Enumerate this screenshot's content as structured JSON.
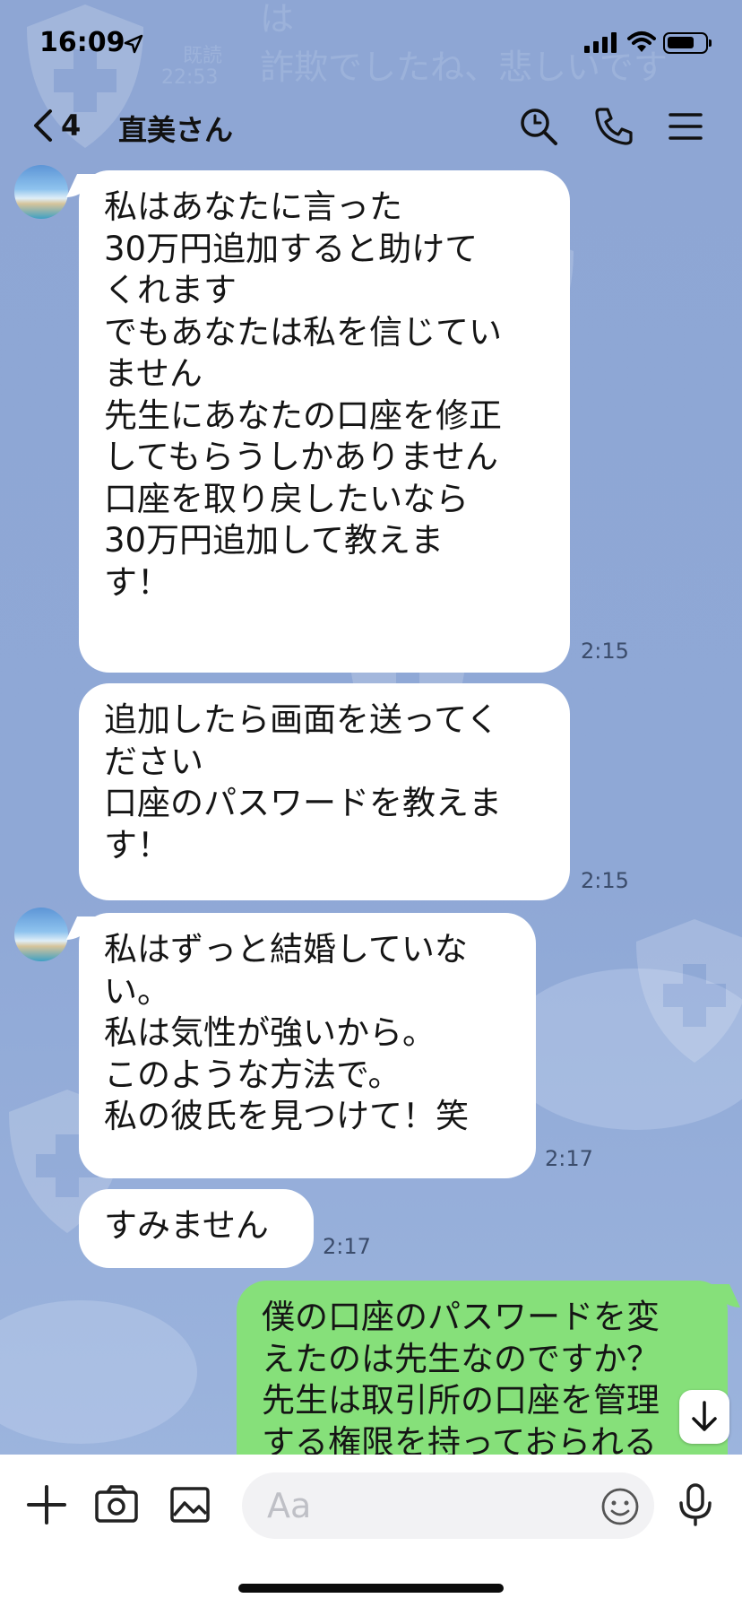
{
  "status_bar": {
    "time": "16:09",
    "location_icon": "location-arrow-icon",
    "signal_icon": "cellular-signal-icon",
    "wifi_icon": "wifi-icon",
    "battery_icon": "battery-icon"
  },
  "ghost_text": {
    "line1": "は",
    "line2": "詐欺でしたね、悲しいです",
    "small_left": "既読",
    "small_time": "22:53"
  },
  "header": {
    "back_count": "4",
    "title": "直美さん",
    "icons": [
      "search-icon",
      "phone-icon",
      "menu-icon"
    ]
  },
  "messages": [
    {
      "side": "received",
      "text": "私はあなたに言った\n30万円追加すると助けて\nくれます\nでもあなたは私を信じてい\nません\n先生にあなたの口座を修正\nしてもらうしかありません\n口座を取り戻したいなら\n30万円追加して教えま\nす！",
      "time": "2:15"
    },
    {
      "side": "received",
      "text": "追加したら画面を送ってく\nださい\n口座のパスワードを教えま\nす！",
      "time": "2:15"
    },
    {
      "side": "received",
      "text": "私はずっと結婚していな\nい。\n私は気性が強いから。\nこのような方法で。\n私の彼氏を見つけて！笑",
      "time": "2:17"
    },
    {
      "side": "received",
      "text": "すみません",
      "time": "2:17"
    },
    {
      "side": "sent",
      "text": "僕の口座のパスワードを変\nえたのは先生なのですか？\n先生は取引所の口座を管理\nする権限を持っておられる"
    }
  ],
  "input": {
    "placeholder": "Aa"
  },
  "bottom_icons": [
    "plus-icon",
    "camera-icon",
    "image-icon",
    "emoji-icon",
    "microphone-icon"
  ],
  "colors": {
    "background": "#8fa8d6",
    "received_bubble": "#ffffff",
    "sent_bubble": "#86e07a"
  }
}
